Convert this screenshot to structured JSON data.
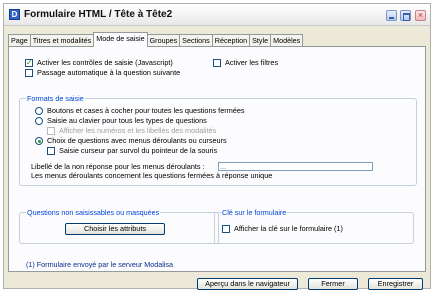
{
  "window": {
    "title": "Formulaire HTML / Tête à Tête2",
    "icon": "app-icon"
  },
  "tabs": [
    {
      "label": "Page",
      "active": false
    },
    {
      "label": "Titres et modalités",
      "active": false
    },
    {
      "label": "Mode de saisie",
      "active": true
    },
    {
      "label": "Groupes",
      "active": false
    },
    {
      "label": "Sections",
      "active": false
    },
    {
      "label": "Réception",
      "active": false
    },
    {
      "label": "Style",
      "active": false
    },
    {
      "label": "Modèles",
      "active": false
    }
  ],
  "options": {
    "js_controls": {
      "label": "Activer les contrôles de saisie (Javascript)",
      "checked": true
    },
    "auto_next": {
      "label": "Passage automatique à la question suivante",
      "checked": false
    },
    "filters": {
      "label": "Activer les filtres",
      "checked": false
    }
  },
  "formats": {
    "title": "Formats de saisie",
    "radio1": {
      "label": "Boutons et cases à cocher pour toutes les questions fermées",
      "checked": false
    },
    "radio2": {
      "label": "Saisie au clavier pour tous les types de questions",
      "checked": false
    },
    "sub_numbers": {
      "label": "Afficher les numéros et les libellés des modalités",
      "checked": false,
      "disabled": true
    },
    "radio3": {
      "label": "Choix de questions avec menus déroulants ou curseurs",
      "checked": true
    },
    "sub_cursor": {
      "label": "Saisie curseur par survol du pointeur de la souris",
      "checked": false
    },
    "nonresponse_label": "Libellé de la non réponse pour les menus déroulants :",
    "nonresponse_value": "...",
    "menus_note": "Les menus déroulants concernent les questions fermées à réponse unique"
  },
  "unseizable": {
    "title": "Questions non saisissables ou masquées",
    "button": "Choisir les attributs"
  },
  "key": {
    "title": "Clé sur le formulaire",
    "checkbox": {
      "label": "Afficher la clé sur le formulaire (1)",
      "checked": false
    }
  },
  "footer": {
    "note": "(1) Formulaire envoyé par le serveur Modalisa",
    "preview_button": "Aperçu dans le navigateur",
    "close_button": "Fermer",
    "save_button": "Enregistrer"
  }
}
